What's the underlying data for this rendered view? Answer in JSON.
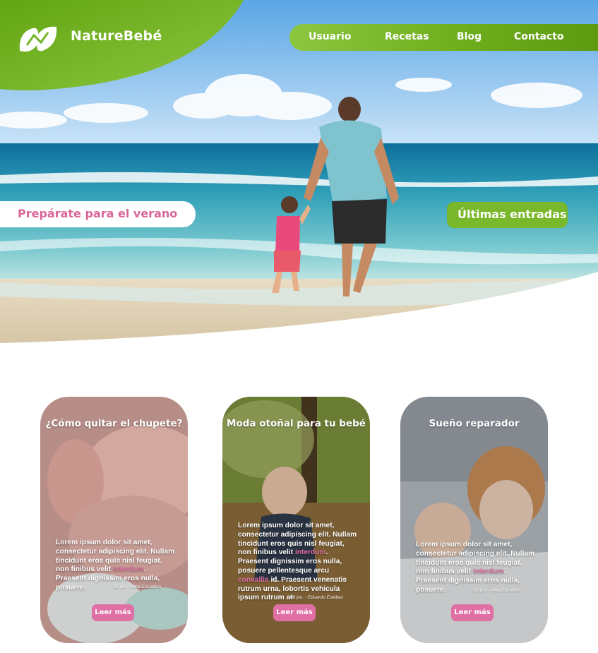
{
  "brand": {
    "name": "NatureBebé",
    "logo_icon": "leaf-n-logo-icon"
  },
  "nav": {
    "items": [
      {
        "label": "Usuario"
      },
      {
        "label": "Recetas"
      },
      {
        "label": "Blog"
      },
      {
        "label": "Contacto"
      }
    ]
  },
  "hero": {
    "promo_label": "Prepárate para el verano",
    "latest_label": "Últimas entradas"
  },
  "colors": {
    "green": "#78b82a",
    "pink": "#e06fa4",
    "white": "#ffffff"
  },
  "cards": [
    {
      "title": "¿Cómo quitar el chupete?",
      "text_before": "Lorem ipsum dolor sit amet, consectetur adipiscing elit. Nullam tincidunt eros quis nisl feugiat, non finibus velit ",
      "highlight": "interdum",
      "text_after": ". Praesent dignissim eros nulla, posuere.",
      "meta": "02 jun. - Alba Escudero",
      "button": "Leer más"
    },
    {
      "title": "Moda otoñal para tu bebé",
      "text_before": "Lorem ipsum dolor sit amet, consectetur adipiscing elit. Nullam tincidunt eros quis nisl feugiat, non finibus velit ",
      "highlight": "interdum",
      "text_after": ". Praesent dignissim eros nulla, posuere pellentesque arcu ",
      "highlight2": "convallis",
      "text_after2": " id. Praesent venenatis rutrum urna, lobortis vehicula ipsum rutrum at",
      "meta": "08 jun. - Eduardo Estébez",
      "button": "Leer más"
    },
    {
      "title": "Sueño reparador",
      "text_before": "Lorem ipsum dolor sit amet, consectetur adipiscing elit. Nullam tincidunt eros quis nisl feugiat, non finibus velit ",
      "highlight": "interdum",
      "text_after": ". Praesent dignissim eros nulla, posuere.",
      "meta": "02 jun. - Alba Escudero",
      "button": "Leer más"
    }
  ]
}
